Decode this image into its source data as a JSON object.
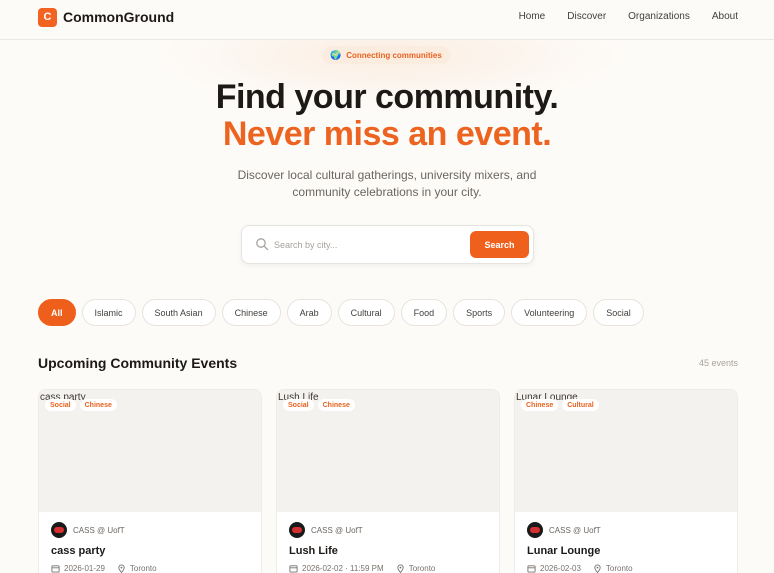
{
  "brand": {
    "logo_letter": "C",
    "name": "CommonGround"
  },
  "nav": [
    "Home",
    "Discover",
    "Organizations",
    "About"
  ],
  "hero": {
    "badge": "Connecting communities",
    "title_line1": "Find your community.",
    "title_line2": "Never miss an event.",
    "subtitle": "Discover local cultural gatherings, university mixers, and community celebrations in your city."
  },
  "search": {
    "placeholder": "Search by city...",
    "button": "Search"
  },
  "filters": [
    "All",
    "Islamic",
    "South Asian",
    "Chinese",
    "Arab",
    "Cultural",
    "Food",
    "Sports",
    "Volunteering",
    "Social"
  ],
  "events": {
    "title": "Upcoming Community Events",
    "count": "45 events",
    "cards": [
      {
        "image_alt": "cass party",
        "tags": [
          "Social",
          "Chinese"
        ],
        "org": "CASS @ UofT",
        "name": "cass party",
        "date": "2026-01-29",
        "location": "Toronto"
      },
      {
        "image_alt": "Lush Life",
        "tags": [
          "Social",
          "Chinese"
        ],
        "org": "CASS @ UofT",
        "name": "Lush Life",
        "date": "2026-02-02 · 11:59 PM",
        "location": "Toronto"
      },
      {
        "image_alt": "Lunar Lounge",
        "tags": [
          "Chinese",
          "Cultural"
        ],
        "org": "CASS @ UofT",
        "name": "Lunar Lounge",
        "date": "2026-02-03",
        "location": "Toronto"
      }
    ]
  },
  "colors": {
    "accent": "#f0601d",
    "background": "#fdfbf8",
    "text": "#1c1917"
  }
}
